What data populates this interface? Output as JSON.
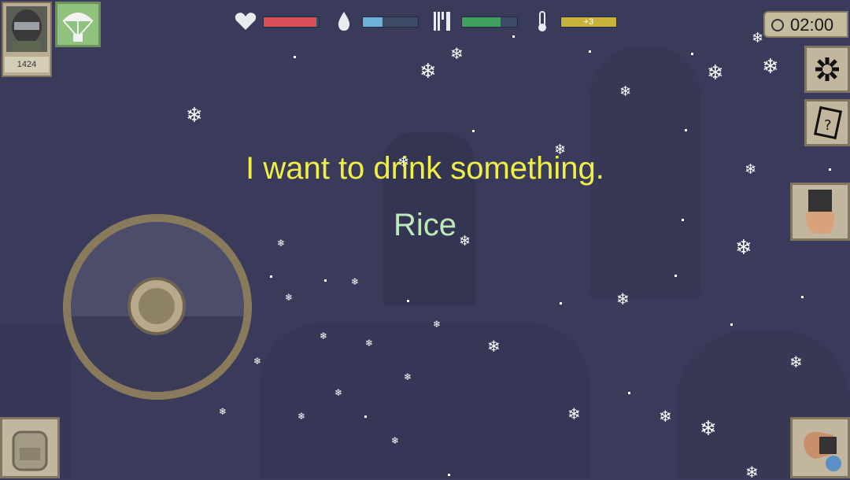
{
  "hud": {
    "health": {
      "icon": "heart-icon",
      "level": 0.95,
      "color": "#d9505a"
    },
    "water": {
      "icon": "water-drop-icon",
      "level": 0.35,
      "color": "#6fb2d9"
    },
    "food": {
      "icon": "fork-knife-icon",
      "level": 0.7,
      "color": "#3fa05d"
    },
    "temperature": {
      "icon": "thermometer-icon",
      "level": 1.0,
      "color": "#c9b23a",
      "label": "+3"
    }
  },
  "player": {
    "score": "1424",
    "icon": "soldier-helmet-icon"
  },
  "airdrop": {
    "icon": "parachute-icon"
  },
  "timer": {
    "time": "02:00",
    "icon": "clock-icon"
  },
  "buttons": {
    "settings": "settings-icon",
    "notes": "notebook-icon",
    "hand": "gloved-hand-icon",
    "backpack": "backpack-icon",
    "swap": "swap-weapon-icon"
  },
  "message": {
    "text": "I want to drink something.",
    "color": "#f0ef45"
  },
  "item": {
    "text": "Rice",
    "color": "#bde8b8"
  }
}
